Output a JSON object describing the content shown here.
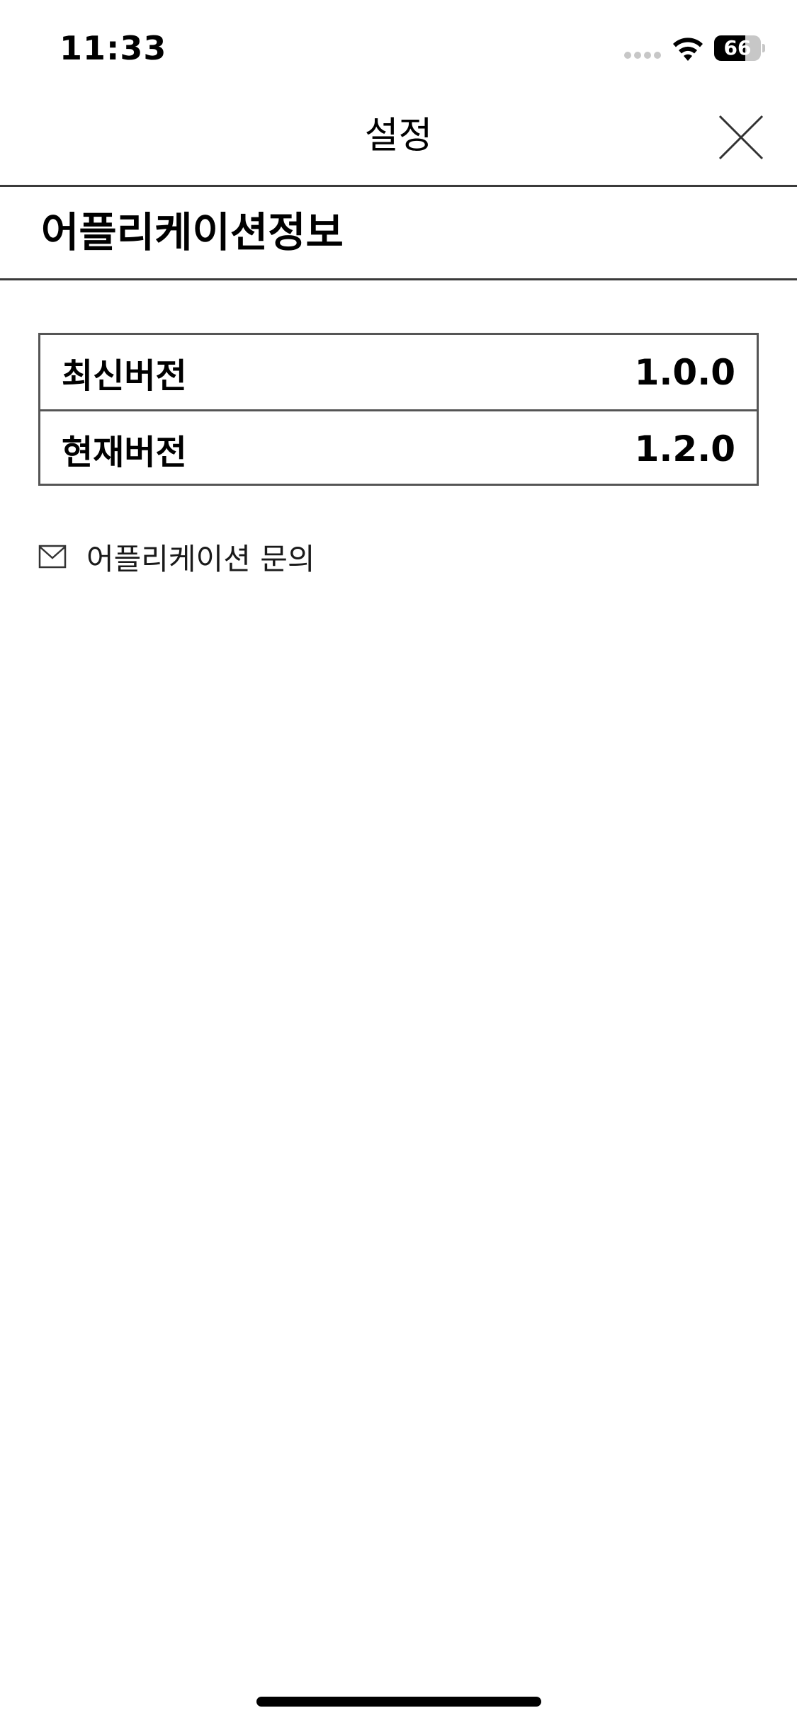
{
  "status_bar": {
    "time": "11:33",
    "battery_level": "66",
    "battery_fraction": 0.66
  },
  "header": {
    "title": "설정",
    "close_icon": "close-icon"
  },
  "section": {
    "title": "어플리케이션정보"
  },
  "versions": [
    {
      "label": "최신버전",
      "value": "1.0.0"
    },
    {
      "label": "현재버전",
      "value": "1.2.0"
    }
  ],
  "inquiry": {
    "icon": "mail-icon",
    "label": "어플리케이션 문의"
  },
  "colors": {
    "background": "#ffffff",
    "text": "#000000",
    "divider": "#3a3a3a",
    "table_border": "#555555"
  }
}
